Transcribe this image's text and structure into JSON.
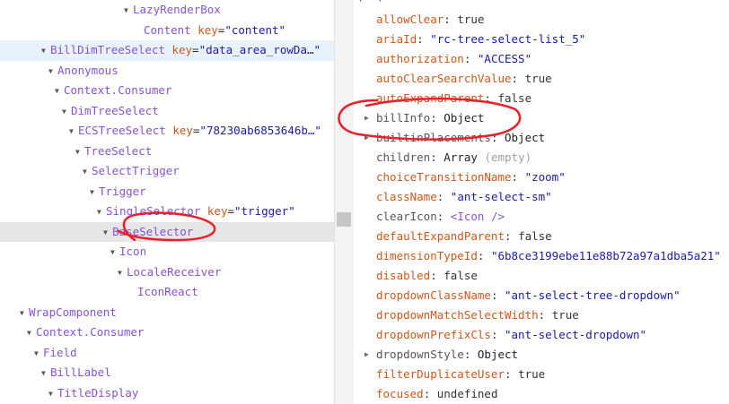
{
  "tree_rows": [
    {
      "tag": "LazyRenderBox",
      "indent": 138,
      "arrow": "▼",
      "attrs": [],
      "state": ""
    },
    {
      "tag": "Content",
      "indent": 160,
      "arrow": "",
      "attrs": [
        {
          "name": "key",
          "value": "\"content\""
        }
      ],
      "state": ""
    },
    {
      "tag": "BillDimTreeSelect",
      "indent": 46,
      "arrow": "▼",
      "attrs": [
        {
          "name": "key",
          "value": "\"data_area_rowDa…\""
        }
      ],
      "state": "selected"
    },
    {
      "tag": "Anonymous",
      "indent": 54,
      "arrow": "▼",
      "attrs": [],
      "state": ""
    },
    {
      "tag": "Context.Consumer",
      "indent": 61,
      "arrow": "▼",
      "attrs": [],
      "state": ""
    },
    {
      "tag": "DimTreeSelect",
      "indent": 69,
      "arrow": "▼",
      "attrs": [],
      "state": ""
    },
    {
      "tag": "ECSTreeSelect",
      "indent": 77,
      "arrow": "▼",
      "attrs": [
        {
          "name": "key",
          "value": "\"78230ab6853646b…\""
        }
      ],
      "state": ""
    },
    {
      "tag": "TreeSelect",
      "indent": 84,
      "arrow": "▼",
      "attrs": [],
      "state": ""
    },
    {
      "tag": "SelectTrigger",
      "indent": 92,
      "arrow": "▼",
      "attrs": [],
      "state": ""
    },
    {
      "tag": "Trigger",
      "indent": 100,
      "arrow": "▼",
      "attrs": [],
      "state": ""
    },
    {
      "tag": "SingleSelector",
      "indent": 108,
      "arrow": "▼",
      "attrs": [
        {
          "name": "key",
          "value": "\"trigger\""
        }
      ],
      "state": ""
    },
    {
      "tag": "BaseSelector",
      "indent": 115,
      "arrow": "▼",
      "attrs": [],
      "state": "hovered"
    },
    {
      "tag": "Icon",
      "indent": 123,
      "arrow": "▼",
      "attrs": [],
      "state": ""
    },
    {
      "tag": "LocaleReceiver",
      "indent": 131,
      "arrow": "▼",
      "attrs": [],
      "state": ""
    },
    {
      "tag": "IconReact",
      "indent": 153,
      "arrow": "",
      "attrs": [],
      "state": ""
    },
    {
      "tag": "WrapComponent",
      "indent": 22,
      "arrow": "▼",
      "attrs": [],
      "state": ""
    },
    {
      "tag": "Context.Consumer",
      "indent": 30,
      "arrow": "▼",
      "attrs": [],
      "state": ""
    },
    {
      "tag": "Field",
      "indent": 38,
      "arrow": "▼",
      "attrs": [],
      "state": ""
    },
    {
      "tag": "BillLabel",
      "indent": 46,
      "arrow": "▼",
      "attrs": [],
      "state": ""
    },
    {
      "tag": "TitleDisplay",
      "indent": 54,
      "arrow": "▼",
      "attrs": [],
      "state": ""
    }
  ],
  "props_header": "props",
  "props": [
    {
      "name": "allowClear",
      "value": "true",
      "kind": "bool",
      "expandable": false
    },
    {
      "name": "ariaId",
      "value": "\"rc-tree-select-list_5\"",
      "kind": "str",
      "expandable": false
    },
    {
      "name": "authorization",
      "value": "\"ACCESS\"",
      "kind": "str",
      "expandable": false
    },
    {
      "name": "autoClearSearchValue",
      "value": "true",
      "kind": "bool",
      "expandable": false
    },
    {
      "name": "autoExpandParent",
      "value": "false",
      "kind": "bool",
      "expandable": false
    },
    {
      "name": "billInfo",
      "value": "Object",
      "kind": "obj",
      "expandable": true
    },
    {
      "name": "builtinPlacements",
      "value": "Object",
      "kind": "obj",
      "expandable": true
    },
    {
      "name": "children",
      "value": "Array",
      "kind": "obj",
      "extra": "(empty)",
      "expandable": false
    },
    {
      "name": "choiceTransitionName",
      "value": "\"zoom\"",
      "kind": "str",
      "expandable": false
    },
    {
      "name": "className",
      "value": "\"ant-select-sm\"",
      "kind": "str",
      "expandable": false
    },
    {
      "name": "clearIcon",
      "value": "<Icon />",
      "kind": "jsx",
      "expandable": false
    },
    {
      "name": "defaultExpandParent",
      "value": "false",
      "kind": "bool",
      "expandable": false
    },
    {
      "name": "dimensionTypeId",
      "value": "\"6b8ce3199ebe11e88b72a97a1dba5a21\"",
      "kind": "str",
      "expandable": false
    },
    {
      "name": "disabled",
      "value": "false",
      "kind": "bool",
      "expandable": false
    },
    {
      "name": "dropdownClassName",
      "value": "\"ant-select-tree-dropdown\"",
      "kind": "str",
      "expandable": false
    },
    {
      "name": "dropdownMatchSelectWidth",
      "value": "true",
      "kind": "bool",
      "expandable": false
    },
    {
      "name": "dropdownPrefixCls",
      "value": "\"ant-select-dropdown\"",
      "kind": "str",
      "expandable": false
    },
    {
      "name": "dropdownStyle",
      "value": "Object",
      "kind": "obj",
      "expandable": true
    },
    {
      "name": "filterDuplicateUser",
      "value": "true",
      "kind": "bool",
      "expandable": false
    },
    {
      "name": "focused",
      "value": "undefined",
      "kind": "bool",
      "expandable": false
    }
  ],
  "colors": {
    "tag": "#8653d1",
    "attr_name": "#c9581d",
    "attr_value": "#1a1aa6",
    "selected_row": "#e8f2fc",
    "hovered_row": "#e6e6e6",
    "annotation": "#e8202a"
  }
}
